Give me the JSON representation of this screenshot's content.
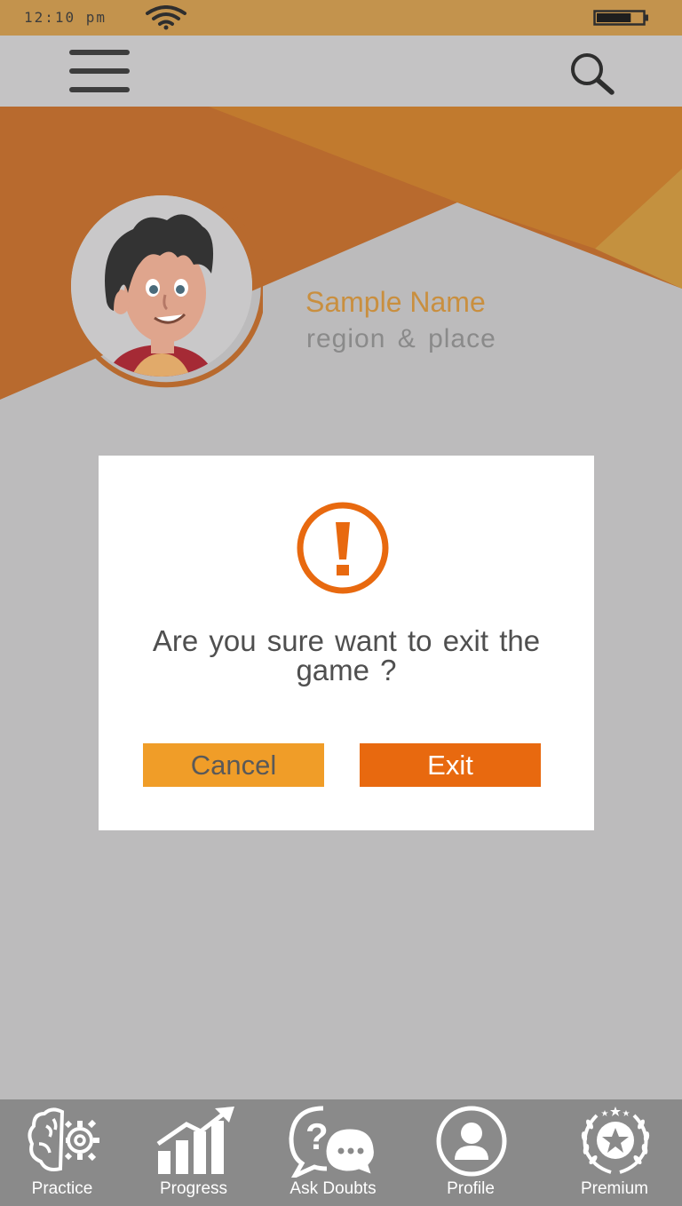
{
  "status_bar": {
    "time": "12:10 pm",
    "wifi_icon": "wifi-icon",
    "battery_icon": "battery-icon",
    "battery_level": 0.75
  },
  "app_bar": {
    "menu_icon": "hamburger-menu-icon",
    "search_icon": "search-icon"
  },
  "profile": {
    "name": "Sample Name",
    "region": "region & place",
    "avatar_icon": "cartoon-boy-avatar"
  },
  "dialog": {
    "icon": "warning-exclamation-icon",
    "message": "Are you sure want to exit the game ?",
    "cancel_label": "Cancel",
    "exit_label": "Exit"
  },
  "bottom_nav": {
    "items": [
      {
        "label": "Practice",
        "icon": "brain-gear-icon"
      },
      {
        "label": "Progress",
        "icon": "bar-chart-arrow-icon"
      },
      {
        "label": "Ask Doubts",
        "icon": "question-chat-icon"
      },
      {
        "label": "Profile",
        "icon": "user-circle-icon"
      },
      {
        "label": "Premium",
        "icon": "laurel-star-icon"
      }
    ]
  },
  "colors": {
    "status_bar": "#c3934d",
    "app_bar": "#c4c3c4",
    "background": "#bcbbbc",
    "accent_orange": "#e8690f",
    "cancel_orange": "#f09d28",
    "name_color": "#c98f3f",
    "bottom_nav": "#8a8a8a"
  }
}
